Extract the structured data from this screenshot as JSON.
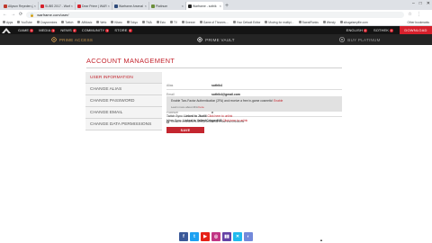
{
  "browser": {
    "tabs": [
      {
        "title": "Allyson Reyeden (Ableish",
        "color": "#c0392b",
        "active": false
      },
      {
        "title": "SUBS 2017 - Warframe",
        "color": "#d6202c",
        "active": false
      },
      {
        "title": "Dear Prime | WARFRAME Wiki",
        "color": "#d6202c",
        "active": false
      },
      {
        "title": "Warframe Arsenal (OC)",
        "color": "#2e4a7a",
        "active": false
      },
      {
        "title": "Platinum",
        "color": "#6b8e3a",
        "active": false
      },
      {
        "title": "Warframe - sothik",
        "color": "#222222",
        "active": true
      }
    ],
    "new_tab": "+",
    "window_controls": [
      "–",
      "□",
      "✕"
    ],
    "url": "warframe.com/user/",
    "back": "←",
    "forward": "→",
    "reload": "⟳",
    "right_icons": [
      "☆",
      "⋮"
    ],
    "bookmarks": [
      "Apps",
      "YouTube",
      "Crayonmixes",
      "Twitch",
      "AllMusic",
      "Welc",
      "Kitaro",
      "Tokyo",
      "TMA",
      "Ezio",
      "TV",
      "Sneeze",
      "Game of Thrones…",
      "Your Default Editor",
      "Moving for multipl…",
      "SweatFlanks",
      "Wendy",
      "sibugaismyfile.com"
    ],
    "other_bookmarks": "Other bookmarks"
  },
  "site_nav": {
    "logo_icon": "warframe-logo",
    "items": [
      {
        "label": "GAME"
      },
      {
        "label": "MEDIA"
      },
      {
        "label": "NEWS"
      },
      {
        "label": "COMMUNITY"
      },
      {
        "label": "STORE"
      }
    ],
    "language": "ENGLISH",
    "username": "SOTHEK",
    "download": "DOWNLOAD",
    "accent_color": "#d6202c"
  },
  "subnav": {
    "items": [
      {
        "label": "PRIME ACCESS"
      },
      {
        "label": "PRIME VAULT"
      },
      {
        "label": "BUY PLATINUM"
      }
    ]
  },
  "account": {
    "heading": "ACCOUNT MANAGEMENT",
    "menu": [
      {
        "label": "USER INFORMATION",
        "active": true
      },
      {
        "label": "CHANGE ALIAS",
        "active": false
      },
      {
        "label": "CHANGE PASSWORD",
        "active": false
      },
      {
        "label": "CHANGE EMAIL",
        "active": false
      },
      {
        "label": "CHANGE DATA PERMISSIONS",
        "active": false
      }
    ],
    "fields": [
      {
        "label": "Alias",
        "value": "sothik4"
      },
      {
        "label": "Email",
        "value": "sothik4@gmail.com"
      },
      {
        "label": "Member for",
        "value": "3 months"
      },
      {
        "label": "Platinum",
        "value": "0"
      }
    ],
    "newsletter_label": "Receive newsletters and promotional email transmissions",
    "save_label": "SAVE"
  },
  "tfa": {
    "text": "Enable Two-Factor Authentication (2FA) and receive a free in-game cosmetic!",
    "link": "Enable",
    "sub_text": "Learn more about 2FA",
    "sub_link": "here."
  },
  "linked_accounts": {
    "twitch_prefix": "Twitch Sync:",
    "twitch_status": "Linked to Jkutiii",
    "twitch_link": "Click here to unlink",
    "mixer_prefix": "Mixer Sync:",
    "mixer_status": "Linked to ValiantCrisper648",
    "mixer_link": "Click here to unlink"
  },
  "social": [
    {
      "name": "facebook",
      "glyph": "f",
      "color": "#3b5998"
    },
    {
      "name": "twitter",
      "glyph": "t",
      "color": "#1da1f2"
    },
    {
      "name": "youtube",
      "glyph": "▶",
      "color": "#e62117"
    },
    {
      "name": "instagram",
      "glyph": "◎",
      "color": "#c13584"
    },
    {
      "name": "twitch",
      "glyph": "▮▮",
      "color": "#6441a5"
    },
    {
      "name": "mixer",
      "glyph": "✕",
      "color": "#1fbaed"
    },
    {
      "name": "discord",
      "glyph": "◐",
      "color": "#7289da"
    }
  ],
  "scroll_top": "▲"
}
